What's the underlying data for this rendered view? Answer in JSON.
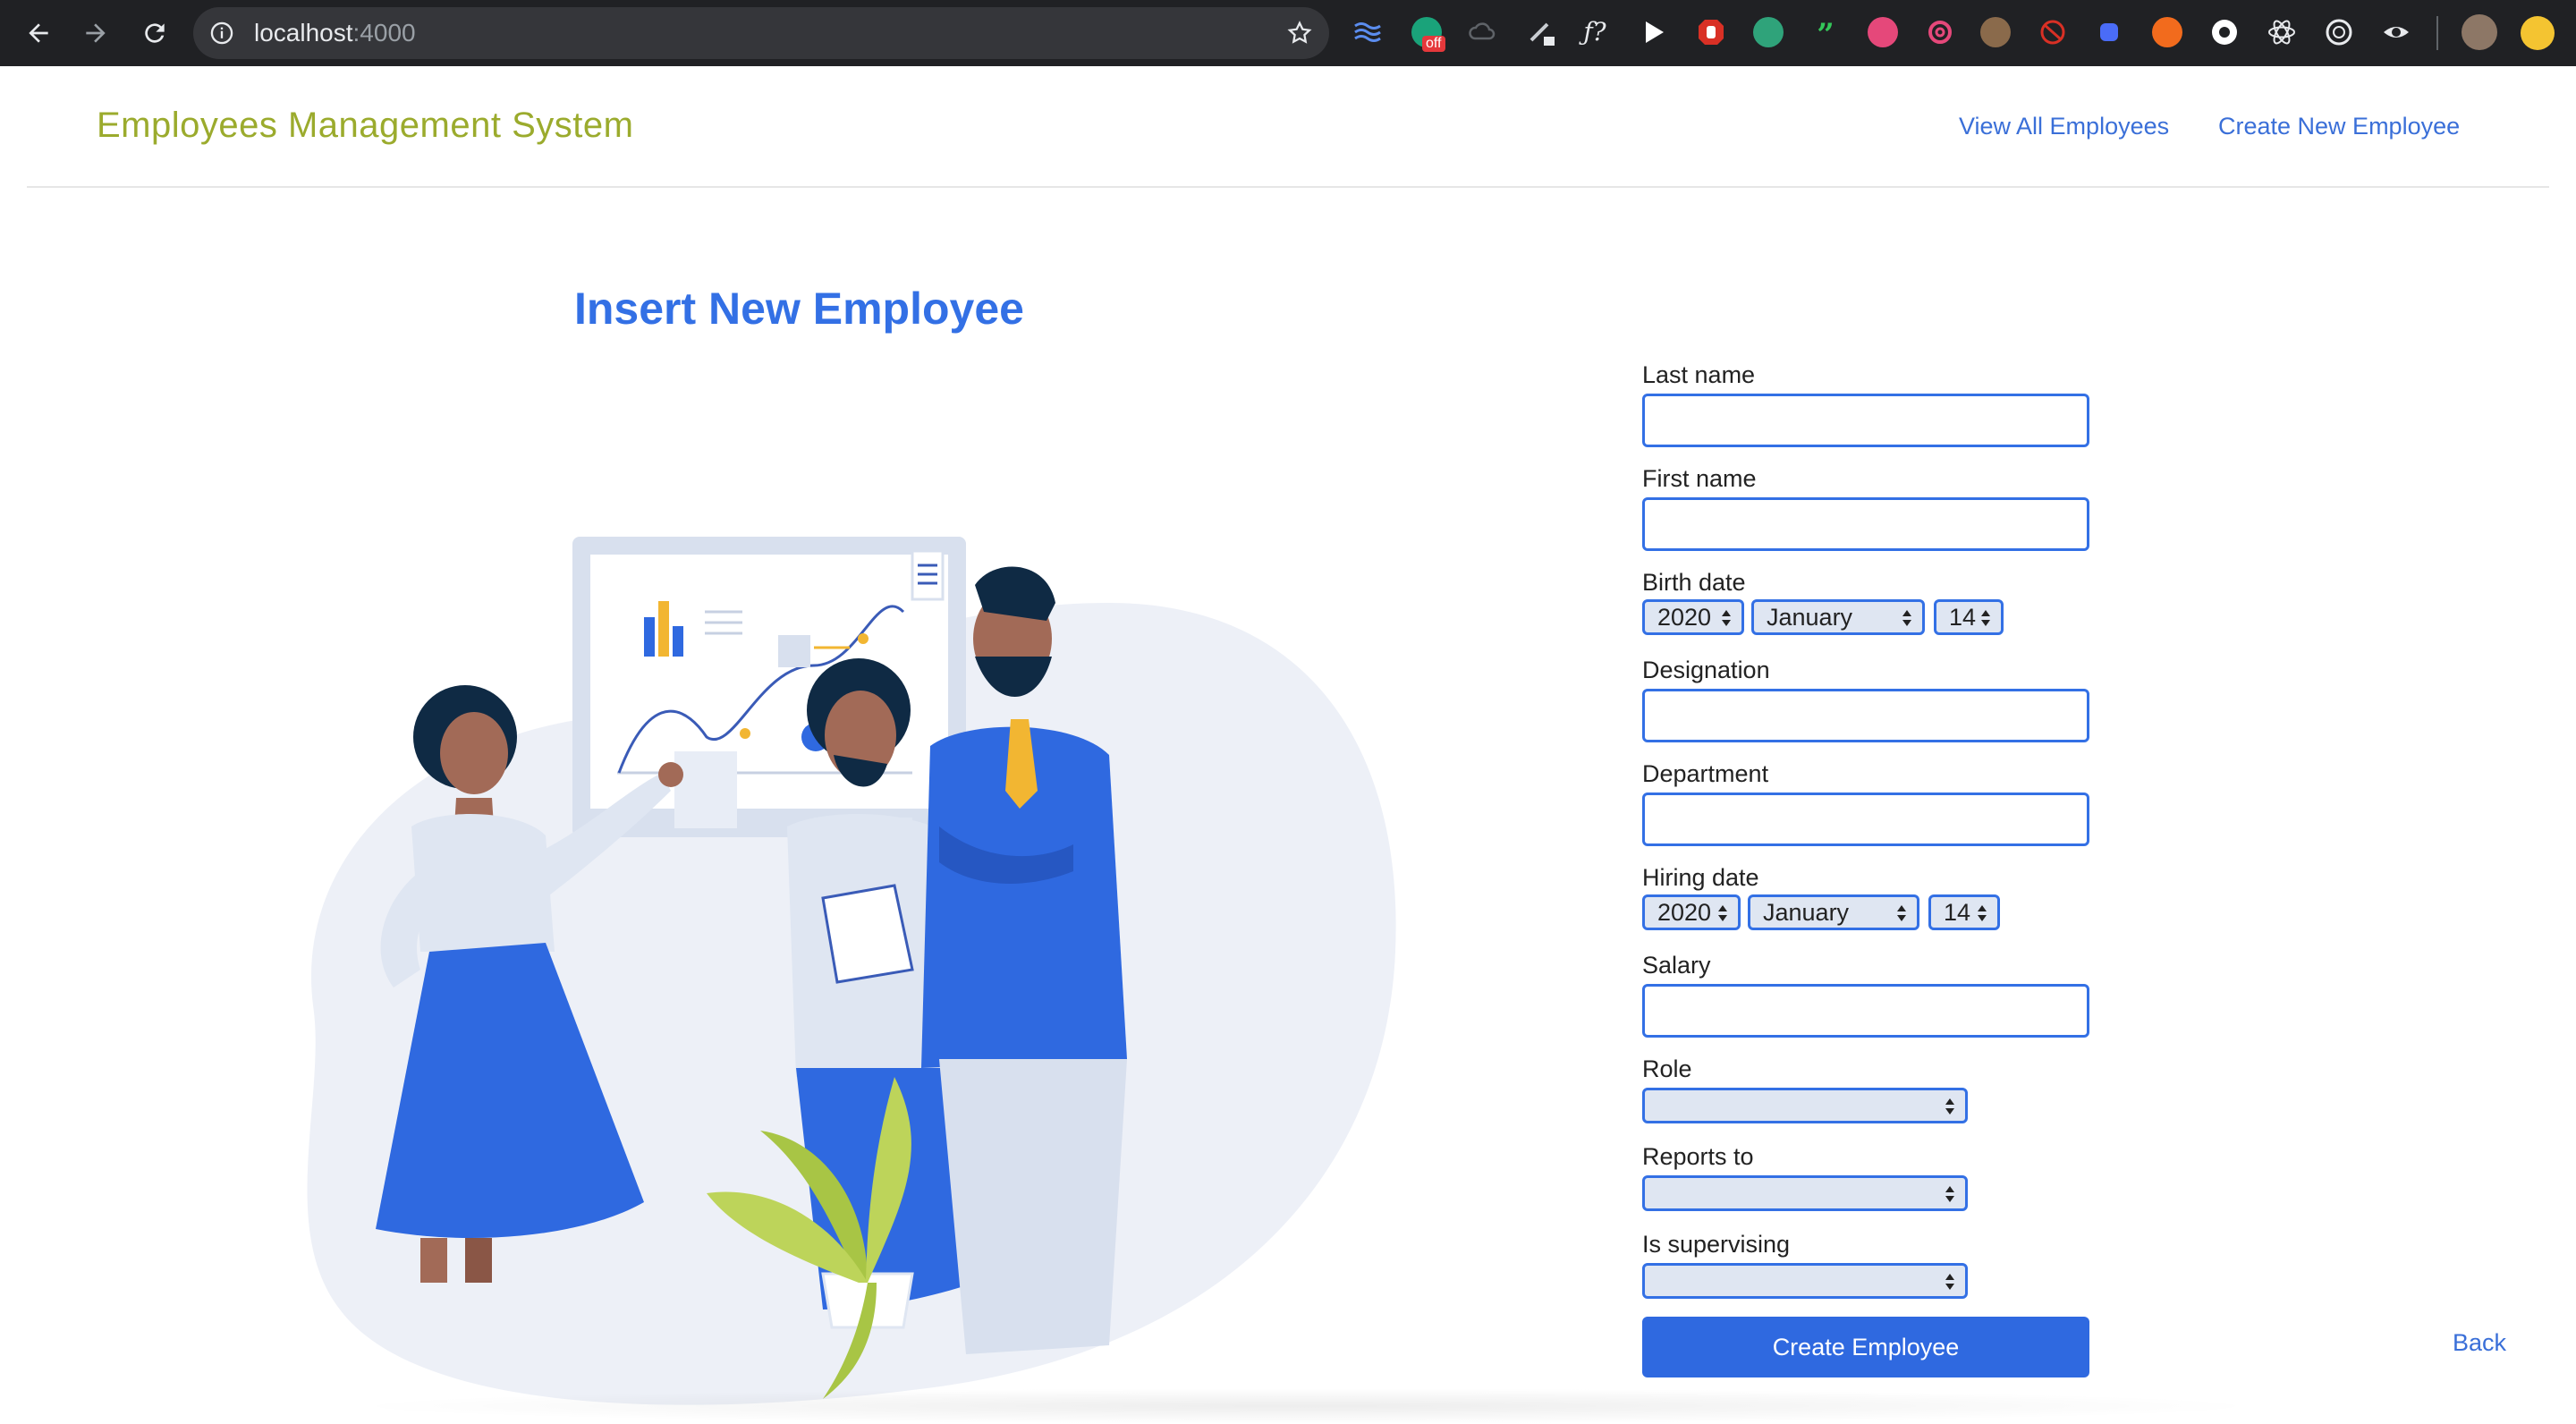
{
  "browser": {
    "url_host": "localhost",
    "url_port": ":4000",
    "extension_badge": "off"
  },
  "header": {
    "brand": "Employees Management System",
    "nav": {
      "view_all": "View All Employees",
      "create_new": "Create New Employee"
    }
  },
  "main": {
    "title": "Insert New Employee"
  },
  "form": {
    "last_name": {
      "label": "Last name",
      "value": ""
    },
    "first_name": {
      "label": "First name",
      "value": ""
    },
    "birth_date": {
      "label": "Birth date",
      "year": "2020",
      "month": "January",
      "day": "14"
    },
    "designation": {
      "label": "Designation",
      "value": ""
    },
    "department": {
      "label": "Department",
      "value": ""
    },
    "hiring_date": {
      "label": "Hiring date",
      "year": "2020",
      "month": "January",
      "day": "14"
    },
    "salary": {
      "label": "Salary",
      "value": ""
    },
    "role": {
      "label": "Role",
      "value": ""
    },
    "reports_to": {
      "label": "Reports to",
      "value": ""
    },
    "is_supervising": {
      "label": "Is supervising",
      "value": ""
    },
    "submit_label": "Create Employee"
  },
  "footer": {
    "back": "Back"
  },
  "colors": {
    "brand": "#9bab2d",
    "accent": "#3370e5",
    "chrome": "#202124"
  }
}
